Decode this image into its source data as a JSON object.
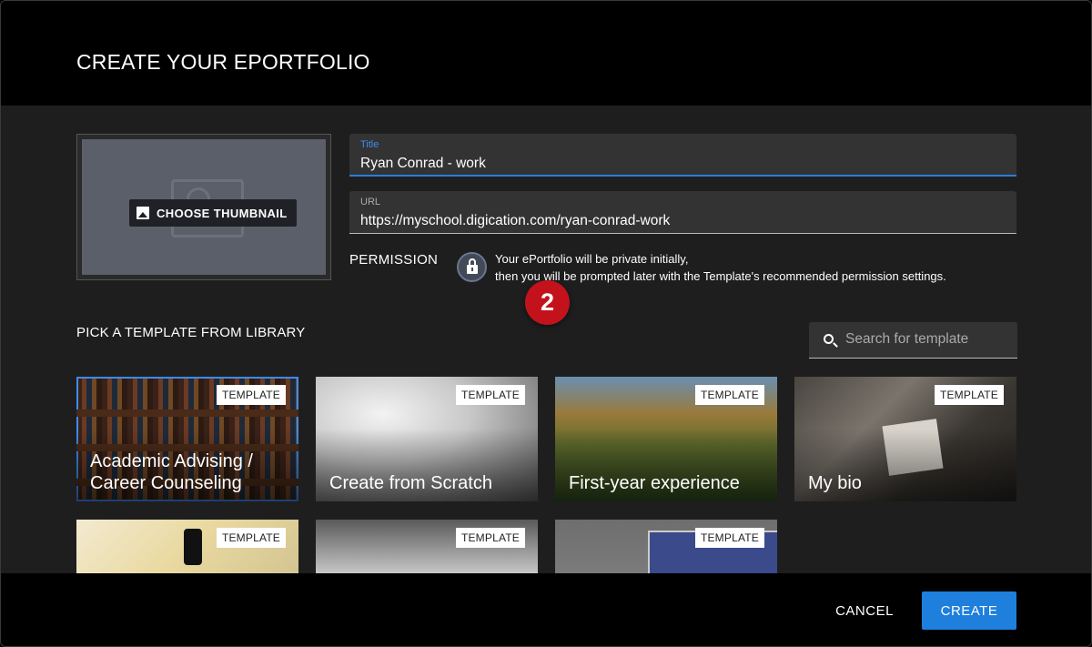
{
  "dialog": {
    "title": "CREATE YOUR EPORTFOLIO"
  },
  "thumbnail": {
    "button_label": "CHOOSE THUMBNAIL",
    "button_icon": "image-icon"
  },
  "fields": {
    "title": {
      "label": "Title",
      "value": "Ryan Conrad - work"
    },
    "url": {
      "label": "URL",
      "value": "https://myschool.digication.com/ryan-conrad-work"
    }
  },
  "permission": {
    "label": "PERMISSION",
    "icon": "lock-icon",
    "line1": "Your ePortfolio will be private initially,",
    "line2": "then you will be prompted later with the Template's recommended permission settings."
  },
  "step_badge": "2",
  "library": {
    "label": "PICK A TEMPLATE FROM LIBRARY",
    "search_placeholder": "Search for template",
    "search_icon": "search-icon",
    "tag_label": "TEMPLATE",
    "templates": [
      {
        "title": "Academic Advising / Career Counseling",
        "selected": true
      },
      {
        "title": "Create from Scratch",
        "selected": false
      },
      {
        "title": "First-year experience",
        "selected": false
      },
      {
        "title": "My bio",
        "selected": false
      },
      {
        "title": "",
        "selected": false
      },
      {
        "title": "",
        "selected": false
      },
      {
        "title": "",
        "selected": false
      }
    ]
  },
  "footer": {
    "cancel_label": "CANCEL",
    "create_label": "CREATE"
  },
  "colors": {
    "accent": "#1e7fdc",
    "badge": "#c4121c",
    "selection": "#3d8cf0"
  }
}
